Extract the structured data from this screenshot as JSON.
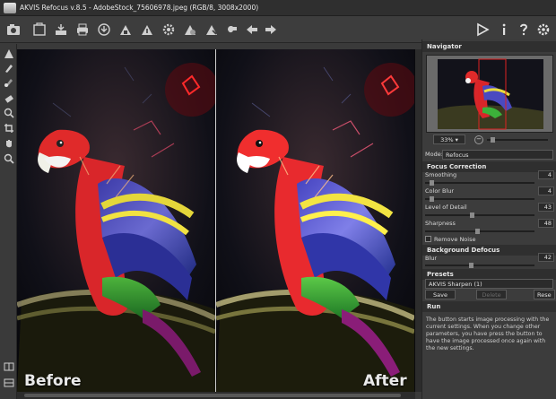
{
  "window": {
    "title": "AKVIS Refocus v.8.5 - AdobeStock_75606978.jpeg (RGB/8, 3008x2000)"
  },
  "canvas": {
    "before_label": "Before",
    "after_label": "After"
  },
  "navigator": {
    "header": "Navigator",
    "zoom": "33%"
  },
  "settings": {
    "mode_label": "Mode:",
    "mode_value": "Refocus",
    "focus_correction_header": "Focus Correction",
    "params": [
      {
        "label": "Smoothing",
        "value": "4",
        "fraction": 0.04
      },
      {
        "label": "Color Blur",
        "value": "4",
        "fraction": 0.04
      },
      {
        "label": "Level of Detail",
        "value": "43",
        "fraction": 0.43
      },
      {
        "label": "Sharpness",
        "value": "48",
        "fraction": 0.48
      }
    ],
    "remove_noise_label": "Remove Noise",
    "remove_noise_checked": false,
    "background_defocus_header": "Background Defocus",
    "blur": {
      "label": "Blur",
      "value": "42",
      "fraction": 0.42
    }
  },
  "presets": {
    "header": "Presets",
    "selected": "AKVIS Sharpen (1)",
    "save_label": "Save",
    "delete_label": "Delete",
    "reset_label": "Rese"
  },
  "run": {
    "header": "Run",
    "description": "The button starts image processing with the current settings. When you change other parameters, you have press the button to have the image processed once again with the new settings."
  },
  "colors": {
    "accent": "#e0e0e0",
    "panel_bg": "#3c3c3c",
    "header_bg": "#2f2f2f"
  }
}
